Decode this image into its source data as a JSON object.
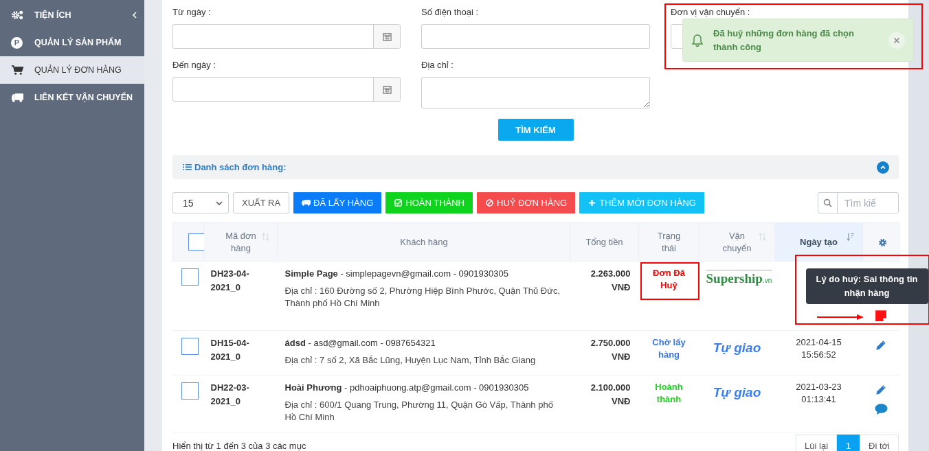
{
  "sidebar": {
    "items": [
      {
        "kind": "gears",
        "label": "TIỆN ÍCH",
        "selected": false,
        "expandable": true
      },
      {
        "kind": "letter",
        "icon_text": "P",
        "label": "QUẢN LÝ SẢN PHẨM",
        "selected": false,
        "expandable": false
      },
      {
        "kind": "cart",
        "label": "QUẢN LÝ ĐƠN HÀNG",
        "selected": true,
        "expandable": false
      },
      {
        "kind": "truck",
        "label": "LIÊN KẾT VẬN CHUYỂN",
        "selected": false,
        "expandable": false
      }
    ]
  },
  "filters": {
    "fields": [
      {
        "kind": "date",
        "label": "Từ ngày :"
      },
      {
        "kind": "text",
        "label": "Số điện thoại :"
      },
      {
        "kind": "select",
        "label": "Đơn vị vận chuyển :"
      },
      {
        "kind": "date",
        "label": "Đến ngày :"
      },
      {
        "kind": "textarea",
        "label": "Địa chỉ :"
      }
    ],
    "search_button": "TÌM KIẾM"
  },
  "toast": {
    "message": "Đã huỷ những đơn hàng đã chọn thành công",
    "highlighted": true
  },
  "list_header": {
    "title": "Danh sách đơn hàng:",
    "expanded": true
  },
  "toolbar": {
    "page_size": "15",
    "buttons": [
      {
        "kind": "plain",
        "label": "XUẤT RA"
      },
      {
        "kind": "truck",
        "label": "ĐÃ LẤY HÀNG",
        "color": "#0a7cf7"
      },
      {
        "kind": "check",
        "label": "HOÀN THÀNH",
        "color": "#0ed41e"
      },
      {
        "kind": "ban",
        "label": "HUỶ ĐƠN HÀNG",
        "color": "#f44c4c"
      },
      {
        "kind": "plus",
        "label": "THÊM MỚI ĐƠN HÀNG",
        "color": "#12c1f5"
      }
    ],
    "search": {
      "placeholder": "Tìm kiế"
    }
  },
  "table": {
    "columns": [
      {
        "kind": "checkbox",
        "checked": false
      },
      {
        "kind": "text",
        "label": "Mã đơn hàng",
        "sortable": true,
        "sorted": false
      },
      {
        "kind": "text",
        "label": "Khách hàng",
        "sortable": false,
        "sorted": false
      },
      {
        "kind": "text",
        "label": "Tổng tiền",
        "sortable": false,
        "sorted": false
      },
      {
        "kind": "text",
        "label": "Trạng thái",
        "sortable": false,
        "sorted": false
      },
      {
        "kind": "text",
        "label": "Vận chuyển",
        "sortable": true,
        "sorted": false
      },
      {
        "kind": "text",
        "label": "Ngày tạo",
        "sortable": true,
        "sorted": true
      },
      {
        "kind": "settings"
      }
    ],
    "rows": [
      {
        "checked": false,
        "code": "DH23-04-2021_0",
        "customer": "**Simple Page** - simplepagevn@gmail.com - 0901930305",
        "address": "Địa chỉ : 160 Đường số 2, Phường Hiệp Bình Phước, Quận Thủ Đức, Thành phố Hồ Chí Minh",
        "total": "2.263.000 VNĐ",
        "status": {
          "label": "Đơn Đã Huỷ",
          "color": "#ff0000"
        },
        "carrier": {
          "kind": "logo",
          "name": "Supership",
          "suffix": ".vn"
        },
        "highlighted": true,
        "actions": [
          {
            "kind": "note",
            "tooltip": "Lý do huỷ: Sai thông tin nhận hàng"
          }
        ]
      },
      {
        "checked": false,
        "code": "DH15-04-2021_0",
        "customer": "**ádsd** - asd@gmail.com - 0987654321",
        "address": "Địa chỉ : 7 số 2, Xã Bắc Lũng, Huyện Lục Nam, Tỉnh Bắc Giang",
        "total": "2.750.000 VNĐ",
        "status": {
          "label": "Chờ lấy hàng",
          "color": "#3a76da"
        },
        "carrier": {
          "kind": "text",
          "name": "Tự giao"
        },
        "date": "2021-04-15 15:56:52",
        "highlighted": false,
        "actions": [
          {
            "kind": "edit"
          }
        ]
      },
      {
        "checked": false,
        "code": "DH22-03-2021_0",
        "customer": "**Hoài Phương** - pdhoaiphuong.atp@gmail.com - 0901930305",
        "address": "Địa chỉ : 600/1 Quang Trung, Phường 11, Quận Gò Vấp, Thành phố Hồ Chí Minh",
        "total": "2.100.000 VNĐ",
        "status": {
          "label": "Hoành thành",
          "color": "#1ed41e"
        },
        "carrier": {
          "kind": "text",
          "name": "Tự giao"
        },
        "date": "2021-03-23 01:13:41",
        "highlighted": false,
        "actions": [
          {
            "kind": "edit"
          },
          {
            "kind": "comment"
          }
        ]
      }
    ]
  },
  "footer": {
    "summary": "Hiển thị từ 1 đến 3 của 3 các mục",
    "pagination": [
      {
        "label": "Lùi lại",
        "selected": false
      },
      {
        "label": "1",
        "selected": true
      },
      {
        "label": "Đi tới",
        "selected": false
      }
    ]
  }
}
